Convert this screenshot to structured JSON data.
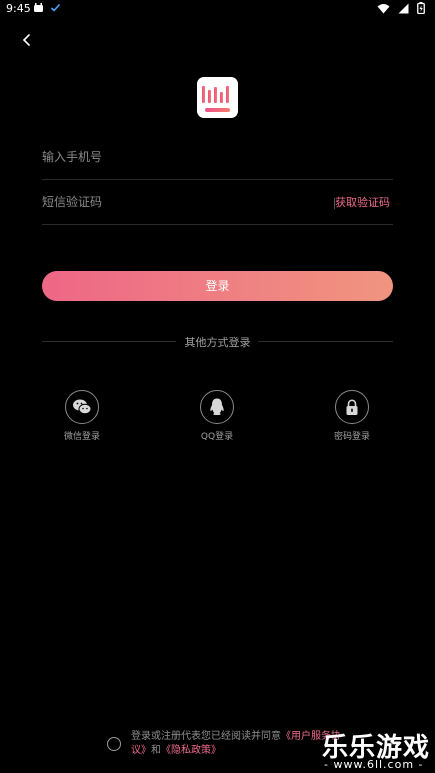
{
  "statusbar": {
    "time": "9:45",
    "left_icons": [
      "android-icon",
      "check-icon"
    ],
    "right_icons": [
      "wifi-icon",
      "signal-icon",
      "battery-icon"
    ]
  },
  "form": {
    "phone_placeholder": "输入手机号",
    "code_placeholder": "短信验证码",
    "get_code_label": "获取验证码"
  },
  "login_button_label": "登录",
  "other_methods": {
    "title": "其他方式登录",
    "items": [
      {
        "label": "微信登录",
        "icon": "wechat-icon"
      },
      {
        "label": "QQ登录",
        "icon": "qq-icon"
      },
      {
        "label": "密码登录",
        "icon": "lock-icon"
      }
    ]
  },
  "agreement": {
    "prefix": "登录或注册代表您已经阅读并同意",
    "user_link": "《用户服务协议》",
    "and": "和",
    "privacy_link": "《隐私政策》"
  },
  "watermark": {
    "title": "乐乐游戏",
    "url": "- www.6ll.com -"
  },
  "colors": {
    "background": "#000000",
    "accent": "#ee6b8f",
    "gradient_start": "#ee6786",
    "gradient_end": "#f0957f"
  }
}
